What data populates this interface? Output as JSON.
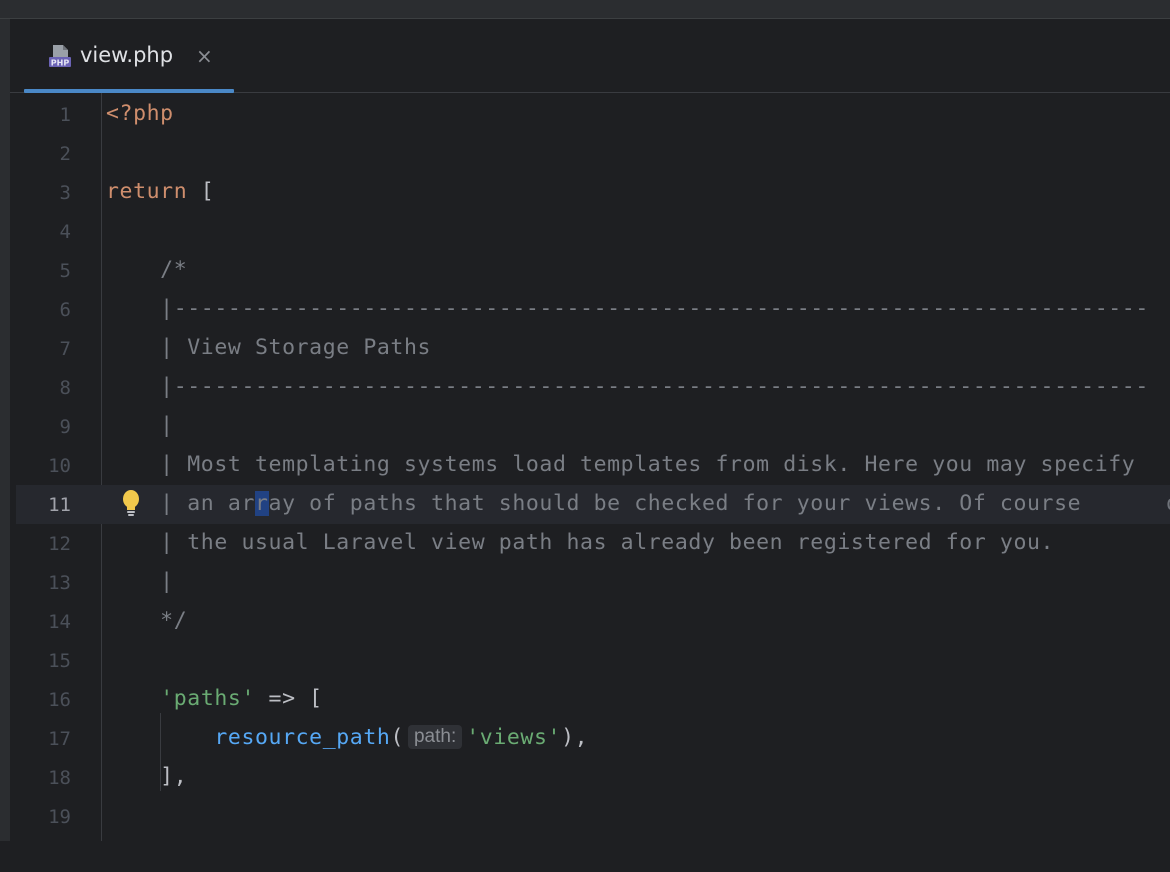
{
  "tab": {
    "icon": "php-file-icon",
    "label": "view.php",
    "close": "×"
  },
  "lines": [
    {
      "n": "1"
    },
    {
      "n": "2"
    },
    {
      "n": "3"
    },
    {
      "n": "4"
    },
    {
      "n": "5"
    },
    {
      "n": "6"
    },
    {
      "n": "7"
    },
    {
      "n": "8"
    },
    {
      "n": "9"
    },
    {
      "n": "10"
    },
    {
      "n": "11"
    },
    {
      "n": "12"
    },
    {
      "n": "13"
    },
    {
      "n": "14"
    },
    {
      "n": "15"
    },
    {
      "n": "16"
    },
    {
      "n": "17"
    },
    {
      "n": "18"
    },
    {
      "n": "19"
    }
  ],
  "code": {
    "l1": "<?php",
    "l3_kw": "return",
    "l3_rest": " [",
    "l5": "    /*",
    "l6": "    |------------------------------------------------------------------------",
    "l7": "    | View Storage Paths",
    "l8": "    |------------------------------------------------------------------------",
    "l9": "    |",
    "l10": "    | Most templating systems load templates from disk. Here you may specify",
    "l11_a": "    | an ar",
    "l11_caret": "r",
    "l11_b": "ay of paths that should be checked for your views. Of course",
    "l11_overflow": "o",
    "l12": "    | the usual Laravel view path has already been registered for you.",
    "l13": "    |",
    "l14": "    */",
    "l16_indent": "    ",
    "l16_str": "'paths'",
    "l16_rest": " => [",
    "l17_indent": "        ",
    "l17_fn": "resource_path",
    "l17_open": "(",
    "l17_hint": "path:",
    "l17_str": "'views'",
    "l17_close": "),",
    "l18": "    ],"
  },
  "icons": {
    "bulb": "lightbulb-icon",
    "close": "close-icon"
  },
  "colors": {
    "background": "#1e1f22",
    "keyword": "#cf8e6d",
    "comment": "#7a7e85",
    "string": "#6aab73",
    "function": "#56a8f5",
    "accent": "#4a88c7"
  }
}
